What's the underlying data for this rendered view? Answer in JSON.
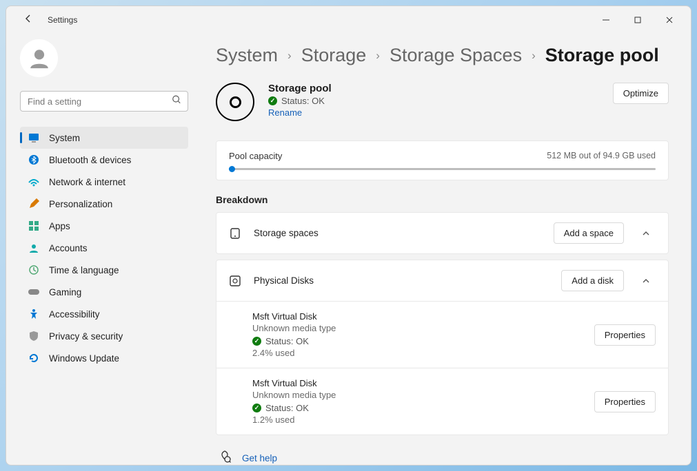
{
  "window": {
    "title": "Settings"
  },
  "search": {
    "placeholder": "Find a setting"
  },
  "nav": [
    {
      "label": "System"
    },
    {
      "label": "Bluetooth & devices"
    },
    {
      "label": "Network & internet"
    },
    {
      "label": "Personalization"
    },
    {
      "label": "Apps"
    },
    {
      "label": "Accounts"
    },
    {
      "label": "Time & language"
    },
    {
      "label": "Gaming"
    },
    {
      "label": "Accessibility"
    },
    {
      "label": "Privacy & security"
    },
    {
      "label": "Windows Update"
    }
  ],
  "breadcrumb": [
    "System",
    "Storage",
    "Storage Spaces",
    "Storage pool"
  ],
  "pool": {
    "title": "Storage pool",
    "status": "Status: OK",
    "rename": "Rename",
    "optimize": "Optimize"
  },
  "capacity": {
    "label": "Pool capacity",
    "usage": "512 MB out of 94.9 GB used"
  },
  "breakdown": {
    "title": "Breakdown",
    "storage_spaces": {
      "label": "Storage spaces",
      "button": "Add a space"
    },
    "physical_disks": {
      "label": "Physical Disks",
      "button": "Add a disk",
      "disks": [
        {
          "name": "Msft Virtual Disk",
          "media": "Unknown media type",
          "status": "Status: OK",
          "used": "2.4% used",
          "props": "Properties"
        },
        {
          "name": "Msft Virtual Disk",
          "media": "Unknown media type",
          "status": "Status: OK",
          "used": "1.2% used",
          "props": "Properties"
        }
      ]
    }
  },
  "help": {
    "label": "Get help"
  }
}
